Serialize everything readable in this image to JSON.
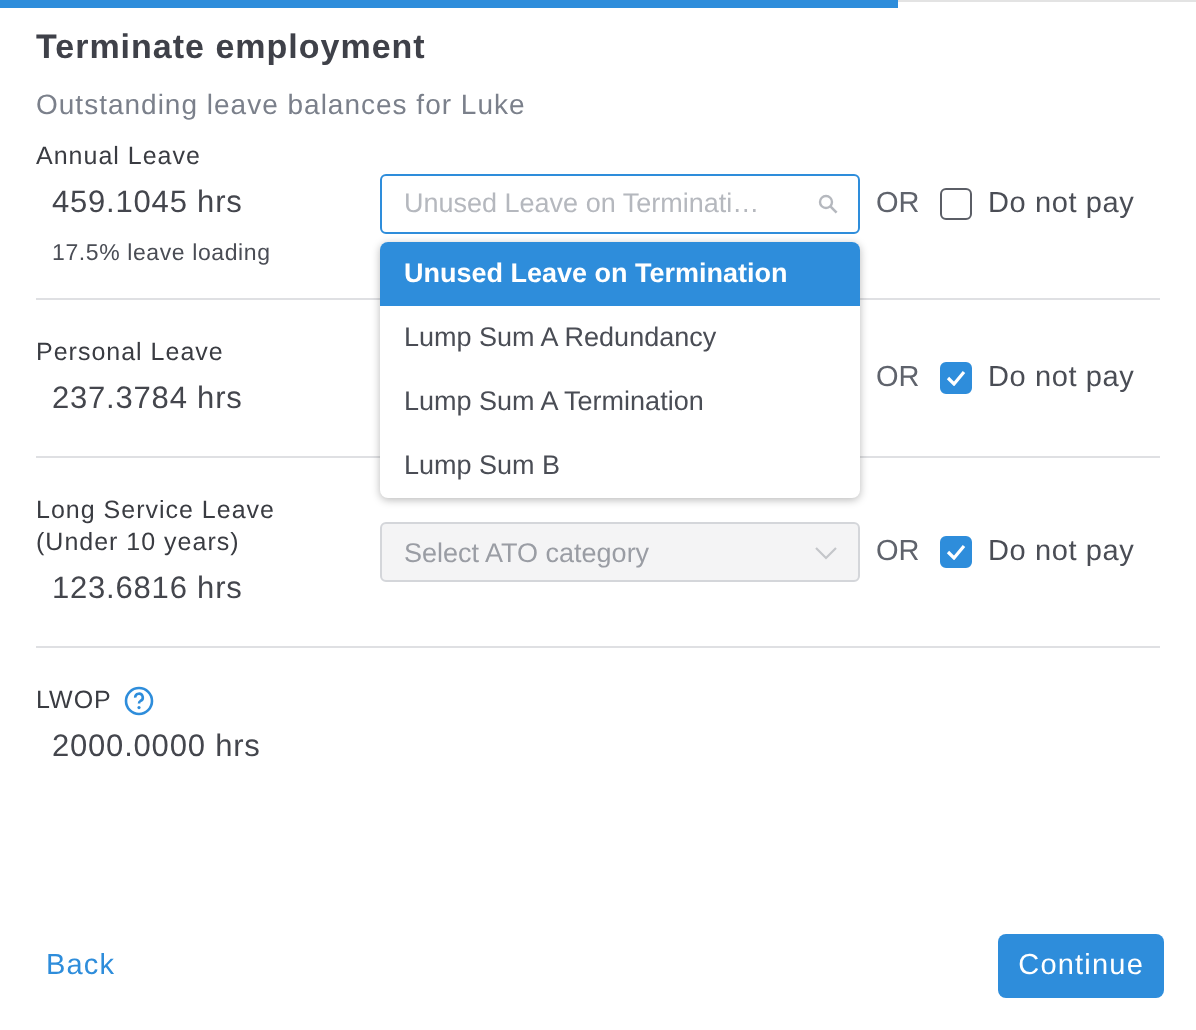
{
  "progress": {
    "level": 0.75
  },
  "title": "Terminate employment",
  "subtitle": "Outstanding leave balances for Luke",
  "leave_types": [
    {
      "name": "Annual Leave",
      "hours": "459.1045 hrs",
      "note": "17.5% leave loading",
      "select": {
        "kind": "search",
        "placeholder": "Unused Leave on Terminati…",
        "focused": true,
        "disabled": false,
        "menu": [
          {
            "label": "Unused Leave on Termination",
            "selected": true
          },
          {
            "label": "Lump Sum A Redundancy",
            "selected": false
          },
          {
            "label": "Lump Sum A Termination",
            "selected": false
          },
          {
            "label": "Lump Sum B",
            "selected": false
          }
        ]
      },
      "or_label": "OR",
      "do_not_pay": {
        "label": "Do not pay",
        "checked": false
      }
    },
    {
      "name": "Personal Leave",
      "hours": "237.3784 hrs",
      "or_label": "OR",
      "do_not_pay": {
        "label": "Do not pay",
        "checked": true
      }
    },
    {
      "name": "Long Service Leave (Under 10 years)",
      "hours": "123.6816 hrs",
      "select": {
        "kind": "dropdown",
        "placeholder": "Select ATO category",
        "focused": false,
        "disabled": true
      },
      "or_label": "OR",
      "do_not_pay": {
        "label": "Do not pay",
        "checked": true
      }
    },
    {
      "name": "LWOP",
      "has_help": true,
      "hours": "2000.0000 hrs"
    }
  ],
  "footer": {
    "back": "Back",
    "continue": "Continue"
  }
}
